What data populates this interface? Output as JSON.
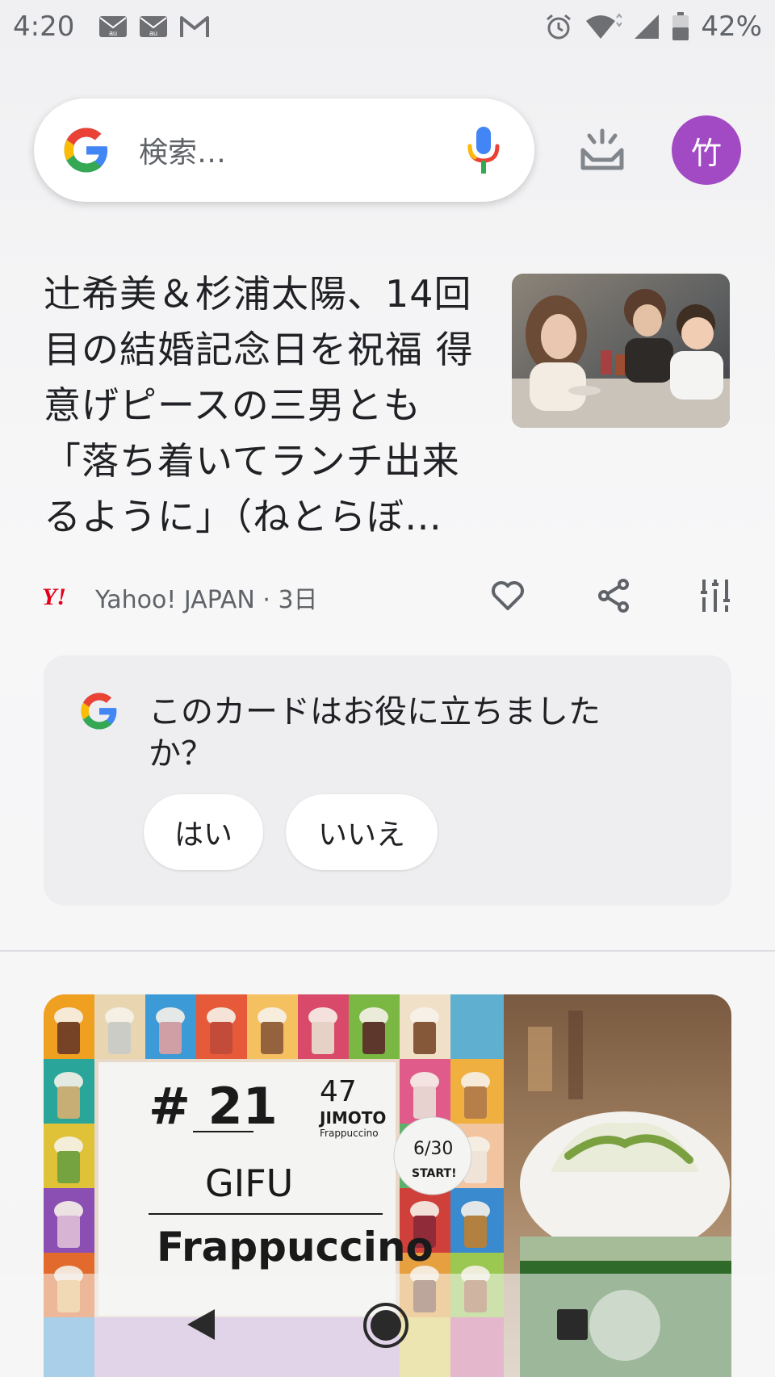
{
  "status_bar": {
    "time": "4:20",
    "battery": "42%",
    "left_icons": [
      "au-mail-icon",
      "au-mail-icon",
      "gmail-icon"
    ],
    "right_icons": [
      "alarm-icon",
      "wifi-icon",
      "signal-icon",
      "battery-icon"
    ]
  },
  "search": {
    "placeholder": "検索…"
  },
  "profile": {
    "initial": "竹",
    "color": "#a24ac4"
  },
  "article": {
    "title": "辻希美＆杉浦太陽、14回目の結婚記念日を祝福 得意げピースの三男とも「落ち着いてランチ出来るように」（ねとらぼ…",
    "source": "Yahoo! JAPAN · 3日",
    "source_logo": "Y!"
  },
  "feedback": {
    "question": "このカードはお役に立ちましたか？",
    "yes_label": "はい",
    "no_label": "いいえ"
  },
  "promo": {
    "number": "# 21",
    "badge_top": "47",
    "badge_name": "JIMOTO",
    "badge_sub": "Frappuccino",
    "date": "6/30",
    "start": "START!",
    "region": "GIFU",
    "product": "Frappuccino"
  },
  "colors": {
    "google_blue": "#4285f4",
    "google_red": "#ea4335",
    "google_yellow": "#fbbc05",
    "google_green": "#34a853",
    "yahoo_red": "#e3001b"
  }
}
